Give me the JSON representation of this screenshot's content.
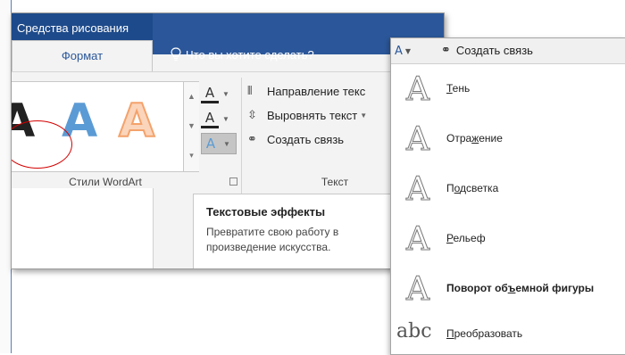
{
  "ribbon": {
    "context_tab_group": "Средства рисования",
    "active_tab": "Формат",
    "tell_me": "Что вы хотите сделать?",
    "wordart_group_label": "Стили WordArt",
    "text_group_label": "Текст",
    "text_buttons": {
      "direction": "Направление текс",
      "align": "Выровнять текст",
      "create_link": "Создать связь"
    },
    "tooltip": {
      "title": "Текстовые эффекты",
      "description": "Превратите свою работу в произведение искусства."
    }
  },
  "dropdown": {
    "header_link": "Создать связь",
    "items": [
      {
        "label_pre": "",
        "label_ul": "Т",
        "label_post": "ень"
      },
      {
        "label_pre": "Отра",
        "label_ul": "ж",
        "label_post": "ение"
      },
      {
        "label_pre": "П",
        "label_ul": "о",
        "label_post": "дсветка"
      },
      {
        "label_pre": "",
        "label_ul": "Р",
        "label_post": "ельеф"
      },
      {
        "label_pre": "Поворот об",
        "label_ul": "ъ",
        "label_post": "емной фигуры"
      },
      {
        "label_pre": "",
        "label_ul": "П",
        "label_post": "реобразовать"
      }
    ]
  },
  "colors": {
    "ribbon_blue": "#2b579a",
    "wordart_blue": "#5b9bd5",
    "wordart_orange": "#f4a26b",
    "annotation_red": "#d40000"
  }
}
